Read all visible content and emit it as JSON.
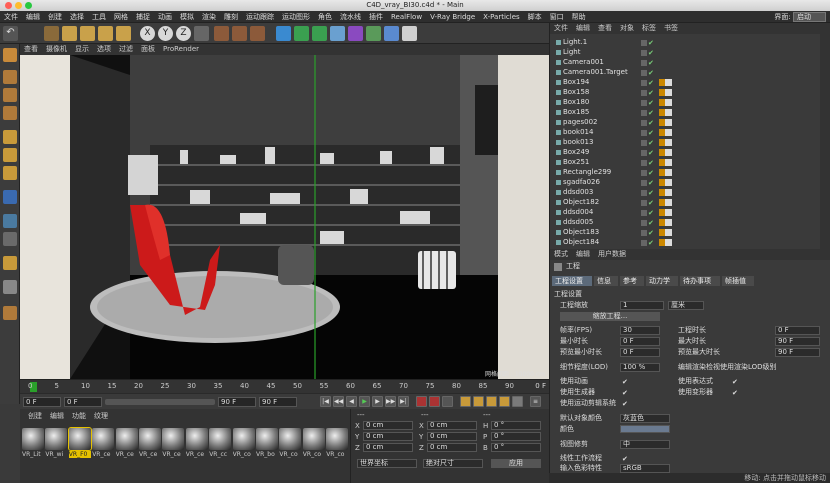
{
  "window": {
    "title": "C4D_vray_BI30.c4d * - Main"
  },
  "menubar": {
    "items": [
      "文件",
      "编辑",
      "创建",
      "选择",
      "工具",
      "网格",
      "捕捉",
      "动画",
      "模拟",
      "渲染",
      "雕刻",
      "运动跟踪",
      "运动图形",
      "角色",
      "流水线",
      "插件",
      "RealFlow",
      "V-Ray Bridge",
      "X-Particles",
      "脚本",
      "窗口",
      "帮助"
    ],
    "layout_label": "界面:",
    "layout_value": "启动"
  },
  "viewport": {
    "menu": [
      "查看",
      "摄像机",
      "显示",
      "选项",
      "过滤",
      "面板",
      "ProRender"
    ],
    "grid_label": "网格间距 : 10000 cm"
  },
  "timeline": {
    "ticks": [
      "0",
      "5",
      "10",
      "15",
      "20",
      "25",
      "30",
      "35",
      "40",
      "45",
      "50",
      "55",
      "60",
      "65",
      "70",
      "75",
      "80",
      "85",
      "90"
    ],
    "end_label": "0 F"
  },
  "playbar": {
    "start": "0 F",
    "start2": "0 F",
    "end": "90 F",
    "end2": "90 F"
  },
  "materials": {
    "menu": [
      "创建",
      "编辑",
      "功能",
      "纹理"
    ],
    "items": [
      "VR_Lit",
      "VR_wi",
      "VR_F0",
      "VR_ce",
      "VR_ce",
      "VR_ce",
      "VR_ce",
      "VR_ce",
      "VR_cc",
      "VR_co",
      "VR_bo",
      "VR_co",
      "VR_co",
      "VR_co"
    ]
  },
  "coords": {
    "header": [
      "---",
      "---",
      "---"
    ],
    "rows": [
      {
        "axis": "X",
        "val": "0 cm",
        "axis2": "X",
        "val2": "0 cm",
        "axis3": "H",
        "val3": "0 °"
      },
      {
        "axis": "Y",
        "val": "0 cm",
        "axis2": "Y",
        "val2": "0 cm",
        "axis3": "P",
        "val3": "0 °"
      },
      {
        "axis": "Z",
        "val": "0 cm",
        "axis2": "Z",
        "val2": "0 cm",
        "axis3": "B",
        "val3": "0 °"
      }
    ],
    "mode1": "世界坐标",
    "mode2": "绝对尺寸",
    "apply": "应用"
  },
  "objects": {
    "menu": [
      "文件",
      "编辑",
      "查看",
      "对象",
      "标签",
      "书签"
    ],
    "items": [
      "Light.1",
      "Light",
      "Camera001",
      "Camera001.Target",
      "Box194",
      "Box158",
      "Box180",
      "Box185",
      "pages002",
      "book014",
      "book013",
      "Box249",
      "Box251",
      "Rectangle299",
      "sgadfa026",
      "ddsd003",
      "Object182",
      "ddsd004",
      "ddsd005",
      "Object183",
      "Object184"
    ]
  },
  "attributes": {
    "menu": [
      "模式",
      "编辑",
      "用户数据"
    ],
    "section_title": "工程",
    "tabs": [
      "工程设置",
      "信息",
      "参考",
      "动力学",
      "待办事项",
      "帧插值"
    ],
    "heading": "工程设置",
    "scale_label": "工程缩放",
    "scale_value": "1",
    "scale_unit": "厘米",
    "scale_button": "缩放工程...",
    "fps_label": "帧率(FPS)",
    "fps_value": "30",
    "duration_label": "工程时长",
    "duration_value": "0 F",
    "min_label": "最小时长",
    "min_value": "0 F",
    "max_label": "最大时长",
    "max_value": "90 F",
    "pmin_label": "预览最小时长",
    "pmin_value": "0 F",
    "pmax_label": "预览最大时长",
    "pmax_value": "90 F",
    "lod_label": "细节程度(LOD)",
    "lod_value": "100 %",
    "lod_render_label": "编辑渲染检视使用渲染LOD级别",
    "anim_label": "使用动画",
    "expr_label": "使用表达式",
    "gen_label": "使用生成器",
    "deform_label": "使用变形器",
    "motion_label": "使用运动剪辑系统",
    "objcolor_label": "默认对象颜色",
    "objcolor_value": "灰蓝色",
    "color_label": "颜色",
    "clip_label": "视图修剪",
    "clip_value": "中",
    "linear_label": "线性工作流程",
    "input_label": "输入色彩特性",
    "input_value": "sRGB"
  },
  "status": {
    "text": "移动: 点击并拖动鼠标移动"
  }
}
